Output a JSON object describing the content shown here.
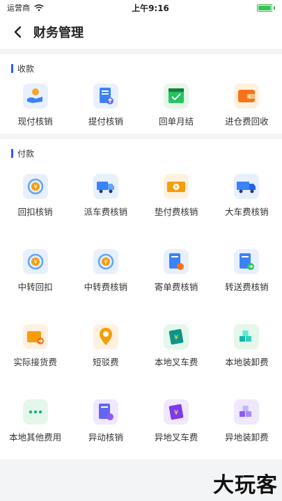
{
  "status": {
    "carrier": "运营商",
    "time": "上午9:16"
  },
  "nav": {
    "title": "财务管理"
  },
  "collect": {
    "title": "收款",
    "items": [
      {
        "label": "现付核销",
        "icon": "hand-coin-icon",
        "color": "#e8f0ff"
      },
      {
        "label": "提付核销",
        "icon": "document-upload-icon",
        "color": "#e8f0ff"
      },
      {
        "label": "回单月结",
        "icon": "calendar-check-icon",
        "color": "#e4f7ea"
      },
      {
        "label": "进仓费回收",
        "icon": "wallet-icon",
        "color": "#fff1e0"
      }
    ]
  },
  "pay": {
    "title": "付款",
    "items": [
      {
        "label": "回扣核销",
        "icon": "rebate-cycle-icon",
        "color": "#e8f0ff"
      },
      {
        "label": "派车费核销",
        "icon": "truck-icon",
        "color": "#e8f0ff"
      },
      {
        "label": "垫付费核销",
        "icon": "cash-icon",
        "color": "#fff1e0"
      },
      {
        "label": "大车费核销",
        "icon": "big-truck-icon",
        "color": "#e8f0ff"
      },
      {
        "label": "中转回扣",
        "icon": "transfer-cycle-icon",
        "color": "#e8f0ff"
      },
      {
        "label": "中转费核销",
        "icon": "transfer-yen-icon",
        "color": "#e8f0ff"
      },
      {
        "label": "寄单费核销",
        "icon": "mail-doc-icon",
        "color": "#e8f0ff"
      },
      {
        "label": "转送费核销",
        "icon": "forward-doc-icon",
        "color": "#e8f0ff"
      },
      {
        "label": "实际接货费",
        "icon": "receive-goods-icon",
        "color": "#fff1e0"
      },
      {
        "label": "短驳费",
        "icon": "location-pin-icon",
        "color": "#fff1e0"
      },
      {
        "label": "本地叉车费",
        "icon": "forklift-bill-icon",
        "color": "#e4f7ea"
      },
      {
        "label": "本地装卸费",
        "icon": "boxes-icon",
        "color": "#e4f7ea"
      },
      {
        "label": "本地其他费用",
        "icon": "more-icon",
        "color": "#e4f7ea"
      },
      {
        "label": "异动核销",
        "icon": "change-doc-icon",
        "color": "#efe8ff"
      },
      {
        "label": "异地叉车费",
        "icon": "remote-forklift-icon",
        "color": "#efe8ff"
      },
      {
        "label": "异地装卸费",
        "icon": "remote-boxes-icon",
        "color": "#efe8ff"
      }
    ]
  },
  "watermark": "大玩客"
}
